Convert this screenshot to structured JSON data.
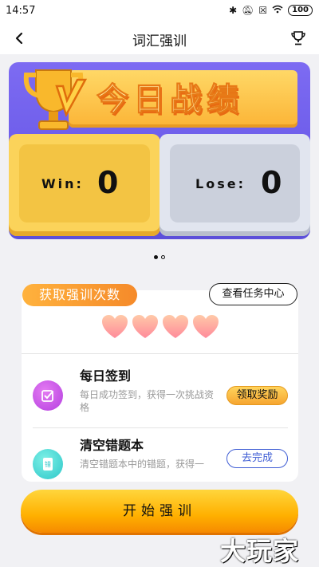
{
  "status_bar": {
    "time": "14:57",
    "battery": "100",
    "icons": [
      "bluetooth-icon",
      "mute-icon",
      "sim-icon",
      "wifi-icon",
      "battery-icon"
    ]
  },
  "nav": {
    "title": "词汇强训",
    "back_icon": "chevron-left-icon",
    "trophy_icon": "trophy-icon"
  },
  "score_card": {
    "banner_text": "今日战绩",
    "win_label": "Win:",
    "win_value": "0",
    "lose_label": "Lose:",
    "lose_value": "0"
  },
  "pager": {
    "count": 2,
    "active": 0
  },
  "tasks": {
    "header_pill": "获取强训次数",
    "task_center_button": "查看任务中心",
    "hearts_count": 4,
    "items": [
      {
        "title": "每日签到",
        "description": "每日成功签到，获得一次挑战资格",
        "button": "领取奖励",
        "icon": "checkin-icon"
      },
      {
        "title": "清空错题本",
        "description": "清空错题本中的错题，获得一",
        "button": "去完成",
        "icon": "notebook-icon"
      }
    ]
  },
  "start_button": "开始强训",
  "watermark": "大玩家",
  "colors": {
    "card_purple": "#6a5ae8",
    "gold": "#ffb000",
    "win_yellow": "#fbd35a",
    "lose_gray": "#e1e5ef",
    "link_blue": "#3f5dd4"
  }
}
